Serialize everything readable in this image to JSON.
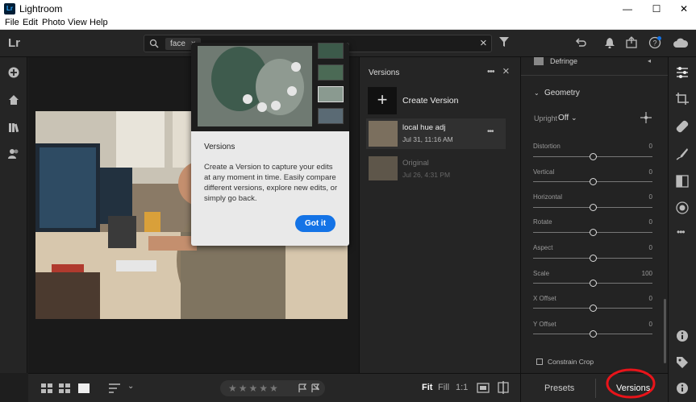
{
  "window": {
    "app_badge": "Lr",
    "title": "Lightroom",
    "minimize": "—",
    "maximize": "☐",
    "close": "✕"
  },
  "menu": [
    "File",
    "Edit",
    "Photo",
    "View",
    "Help"
  ],
  "topbar": {
    "logo": "Lr",
    "search_chip": "face",
    "chip_close": "×",
    "search_clear": "×"
  },
  "popover": {
    "title": "Versions",
    "body": "Create a Version to capture your edits at any moment in time. Easily compare different versions, explore new edits, or simply go back.",
    "button": "Got it"
  },
  "versions_panel": {
    "title": "Versions",
    "more": "•••",
    "close": "×",
    "create_label": "Create Version",
    "create_icon": "+",
    "items": [
      {
        "name": "local hue adj",
        "date": "Jul 31, 11:16 AM",
        "more": "•••"
      },
      {
        "name": "Original",
        "date": "Jul 26, 4:31 PM"
      }
    ]
  },
  "edit_panel": {
    "defringe_label": "Defringe",
    "geometry_label": "Geometry",
    "upright_label": "Upright",
    "upright_value": "Off",
    "sliders": [
      {
        "label": "Distortion",
        "value": "0",
        "level": 0.5
      },
      {
        "label": "Vertical",
        "value": "0",
        "level": 0.5
      },
      {
        "label": "Horizontal",
        "value": "0",
        "level": 0.5
      },
      {
        "label": "Rotate",
        "value": "0",
        "level": 0.5
      },
      {
        "label": "Aspect",
        "value": "0",
        "level": 0.5
      },
      {
        "label": "Scale",
        "value": "100",
        "level": 0.5
      },
      {
        "label": "X Offset",
        "value": "0",
        "level": 0.5
      },
      {
        "label": "Y Offset",
        "value": "0",
        "level": 0.5
      }
    ],
    "constrain_label": "Constrain Crop"
  },
  "bottom_tabs": {
    "presets": "Presets",
    "versions": "Versions"
  },
  "bottombar": {
    "fit": "Fit",
    "fill": "Fill",
    "ratio": "1:1",
    "stars": "★★★★★"
  },
  "colors": {
    "accent": "#1473e6",
    "annotation": "#e8141a"
  }
}
